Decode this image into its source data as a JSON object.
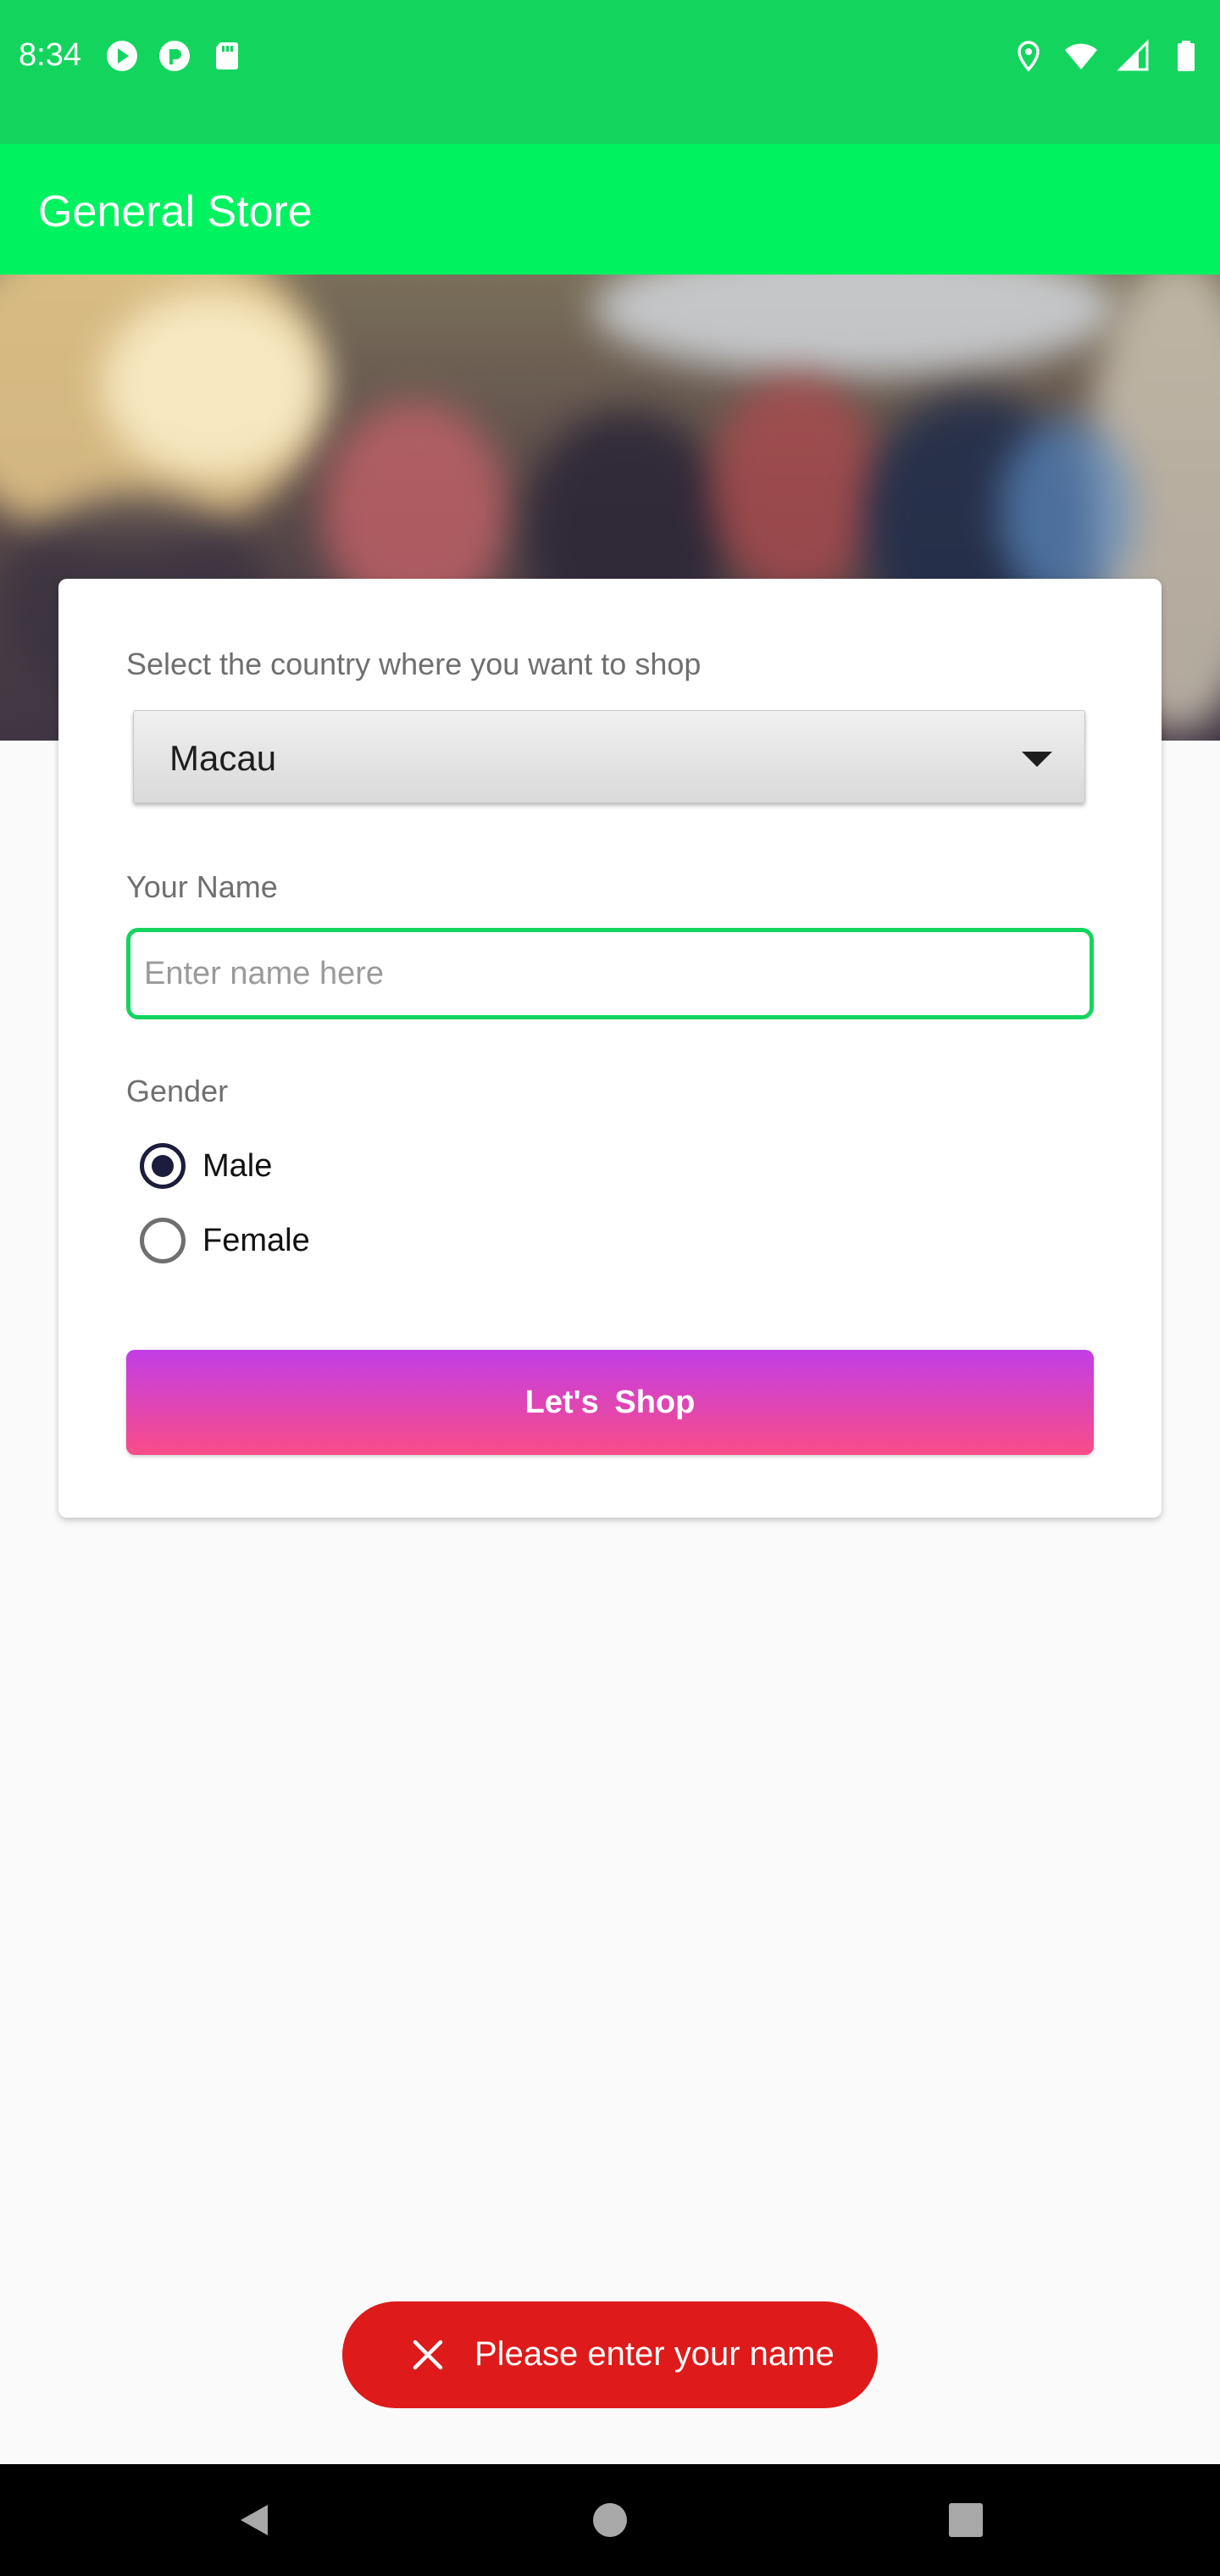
{
  "status_bar": {
    "time": "8:34",
    "left_icons": [
      "play-store-icon",
      "pocket-casts-icon",
      "sd-card-icon"
    ],
    "right_icons": [
      "location-icon",
      "wifi-icon",
      "signal-icon",
      "battery-icon"
    ]
  },
  "app_bar": {
    "title": "General Store"
  },
  "form": {
    "country_label": "Select the country where you want to shop",
    "country_selected": "Macau",
    "name_label": "Your Name",
    "name_placeholder": "Enter name here",
    "name_value": "",
    "gender_label": "Gender",
    "gender_options": [
      {
        "label": "Male",
        "checked": true
      },
      {
        "label": "Female",
        "checked": false
      }
    ],
    "shop_button": "Let's  Shop"
  },
  "toast": {
    "icon": "close-icon",
    "message": "Please enter your name",
    "color": "#de1a1a"
  },
  "nav_bar": {
    "icons": [
      "back-icon",
      "home-icon",
      "recents-icon"
    ]
  },
  "colors": {
    "status_bar": "#13d55e",
    "app_bar": "#00f35f",
    "input_focus": "#13d55e",
    "button_gradient_top": "#c23de6",
    "button_gradient_bottom": "#f94d87"
  }
}
